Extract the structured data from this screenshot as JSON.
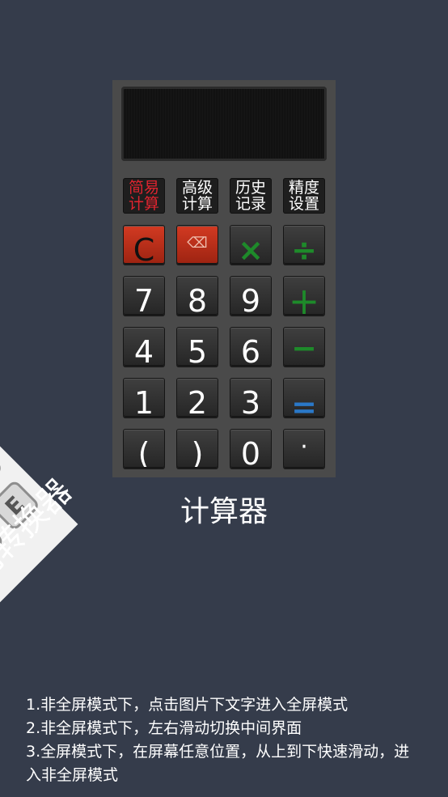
{
  "side_panel": {
    "keys": [
      "B",
      "E",
      "E"
    ],
    "title": "制转换器"
  },
  "calculator": {
    "mode_tabs": [
      {
        "line1": "简易",
        "line2": "计算",
        "active": true
      },
      {
        "line1": "高级",
        "line2": "计算",
        "active": false
      },
      {
        "line1": "历史",
        "line2": "记录",
        "active": false
      },
      {
        "line1": "精度",
        "line2": "设置",
        "active": false
      }
    ],
    "keys": {
      "clear": "C",
      "backspace": "⌫",
      "multiply": "×",
      "divide": "÷",
      "seven": "7",
      "eight": "8",
      "nine": "9",
      "plus": "+",
      "four": "4",
      "five": "5",
      "six": "6",
      "minus": "−",
      "one": "1",
      "two": "2",
      "three": "3",
      "equals": "=",
      "lparen": "(",
      "rparen": ")",
      "zero": "0",
      "dot": "·"
    },
    "colors": {
      "operator_green": "#1e8a2a",
      "equals_blue": "#2a78c8",
      "active_red": "#e0242f"
    }
  },
  "app_name": "计算器",
  "tips": [
    "1.非全屏模式下，点击图片下文字进入全屏模式",
    "2.非全屏模式下，左右滑动切换中间界面",
    "3.全屏模式下，在屏幕任意位置，从上到下快速滑动，进入非全屏模式"
  ]
}
